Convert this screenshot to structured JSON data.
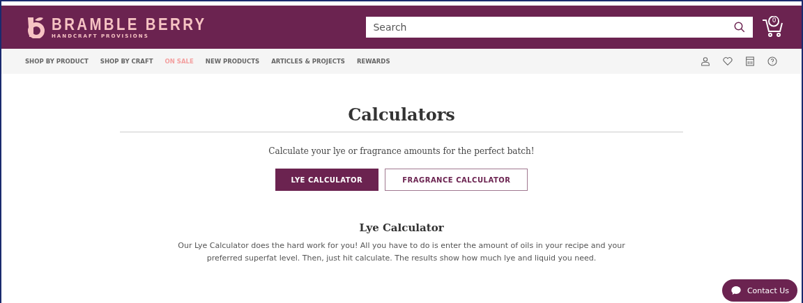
{
  "header": {
    "brand": "BRAMBLE BERRY",
    "tagline": "HANDCRAFT PROVISIONS",
    "search": {
      "placeholder": "Search"
    },
    "cart_count": "0"
  },
  "nav": [
    {
      "label": "SHOP BY PRODUCT",
      "highlighted": false
    },
    {
      "label": "SHOP BY CRAFT",
      "highlighted": false
    },
    {
      "label": "ON SALE",
      "highlighted": true
    },
    {
      "label": "NEW PRODUCTS",
      "highlighted": false
    },
    {
      "label": "ARTICLES & PROJECTS",
      "highlighted": false
    },
    {
      "label": "REWARDS",
      "highlighted": false
    }
  ],
  "page": {
    "title": "Calculators",
    "subtitle": "Calculate your lye or fragrance amounts for the perfect batch!",
    "tabs": [
      {
        "label": "LYE CALCULATOR",
        "selected": true
      },
      {
        "label": "FRAGRANCE CALCULATOR",
        "selected": false
      }
    ],
    "section_title": "Lye Calculator",
    "section_text": "Our Lye Calculator does the hard work for you! All you have to do is enter the amount of oils in your recipe and your preferred superfat level. Then, just hit calculate. The results show how much lye and liquid you need."
  },
  "contact_button": "Contact Us"
}
